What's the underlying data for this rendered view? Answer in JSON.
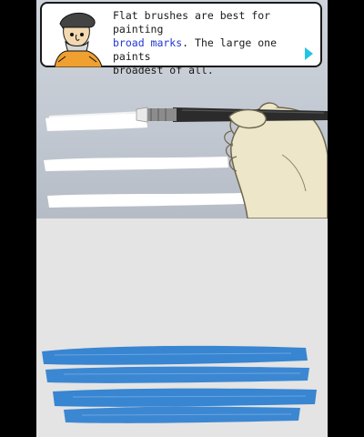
{
  "dialog": {
    "line1": "Flat brushes are best for painting",
    "highlight": "broad marks",
    "line2_rest": ". The large one paints",
    "line3": "broadest of all.",
    "speaker_icon": "bearded-artist-portrait",
    "next_icon": "next-arrow-triangle",
    "colors": {
      "text": "#1a1a1a",
      "highlight": "#1f36d1",
      "arrow": "#22c4e6"
    }
  },
  "top_scene": {
    "white_stroke_color": "#ffffff",
    "brush_icon": "flat-paintbrush-in-hand"
  },
  "canvas": {
    "stroke_color": "#2e7fd0",
    "background": "#e4e4e4"
  }
}
